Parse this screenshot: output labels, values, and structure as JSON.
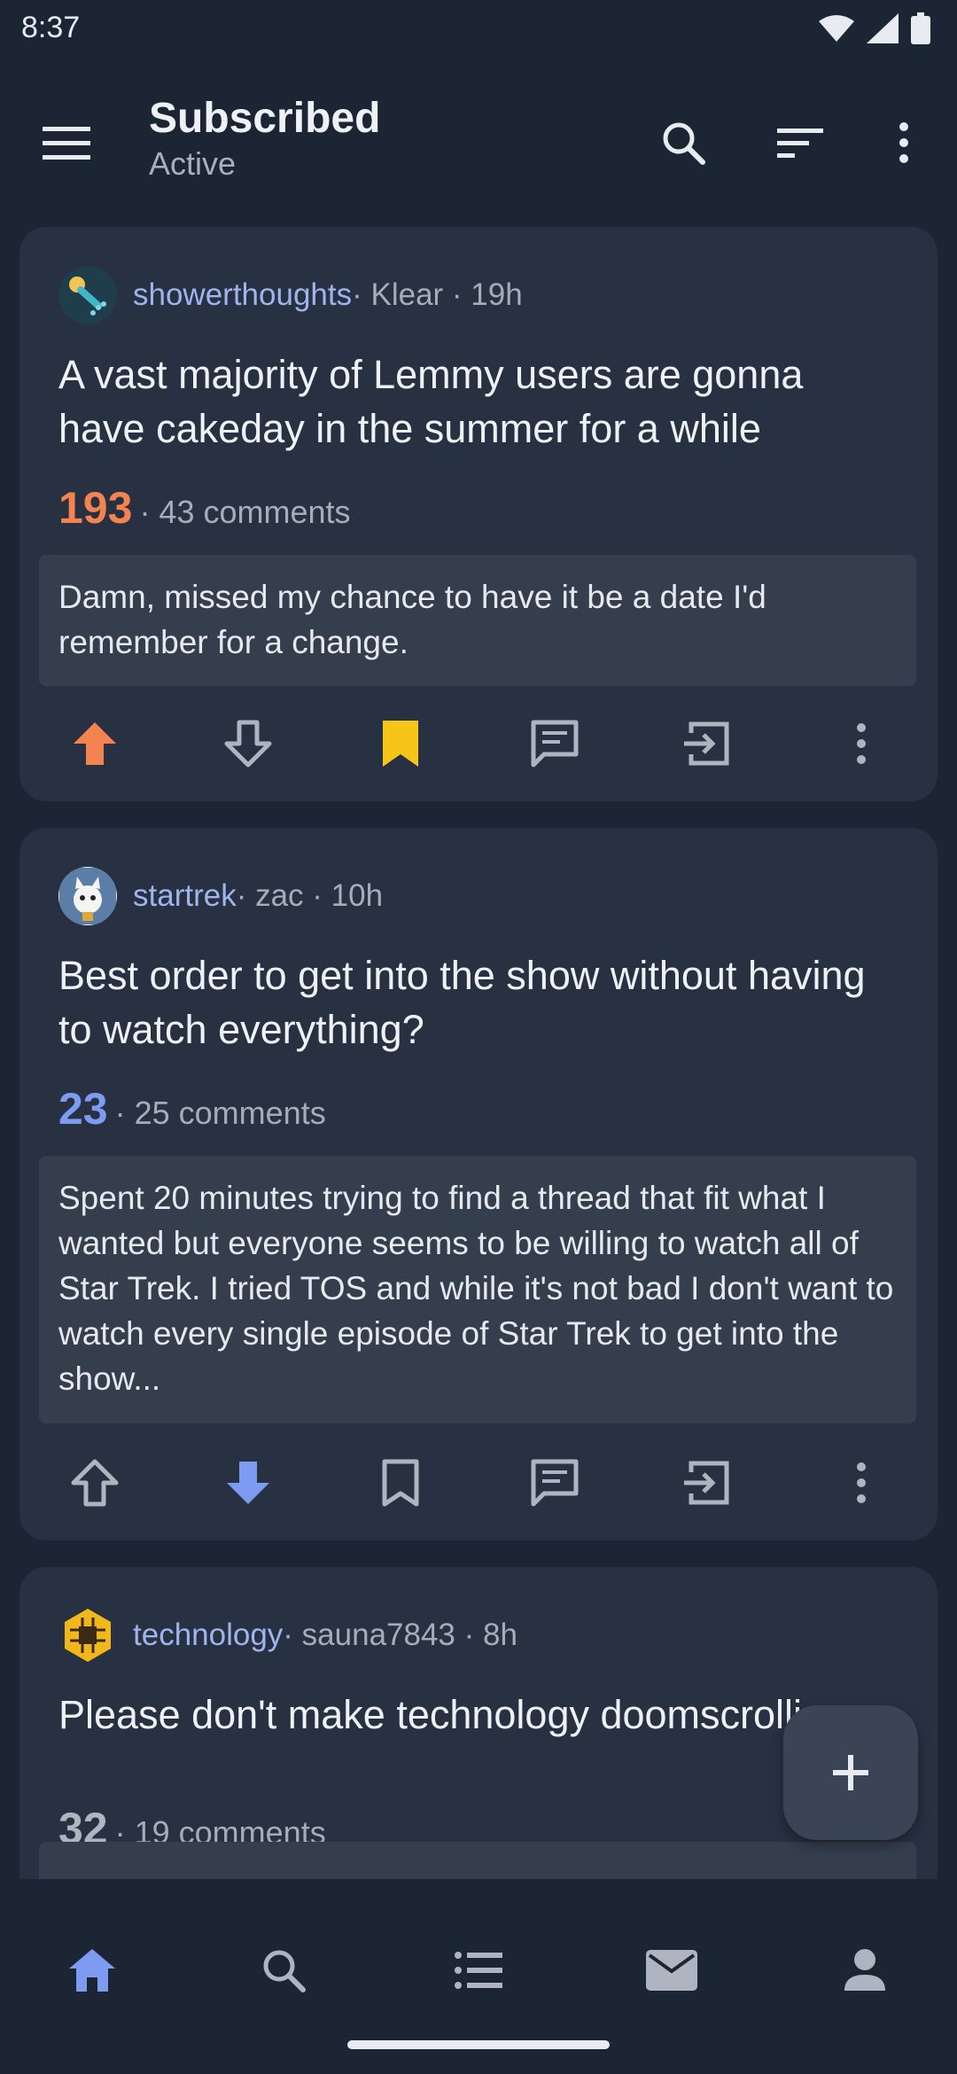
{
  "status_bar": {
    "time": "8:37"
  },
  "app_bar": {
    "title": "Subscribed",
    "subtitle": "Active",
    "icons": [
      "menu-icon",
      "search-icon",
      "sort-icon",
      "more-vert-icon"
    ]
  },
  "posts": [
    {
      "community": "showerthoughts",
      "meta": " · Klear · 19h",
      "title": "A vast majority of Lemmy users are gonna have cakeday in the summer for a while",
      "score": "193",
      "comments": " · 43 comments",
      "body": "Damn, missed my chance to have it be a date I'd remember for a change.",
      "vote_state": "upvoted",
      "saved": true
    },
    {
      "community": "startrek",
      "meta": " · zac · 10h",
      "title": "Best order to get into the show without having to watch everything?",
      "score": "23",
      "comments": " · 25 comments",
      "body": "Spent 20 minutes trying to find a thread that fit what I wanted but everyone seems to be willing to watch all of Star Trek. I tried TOS and while it's not bad I don't want to watch every single episode of Star Trek to get into the show...",
      "vote_state": "downvoted",
      "saved": false
    },
    {
      "community": "technology",
      "meta": " · sauna7843 · 8h",
      "title": "Please don't make technology doomscrolli",
      "score": "32",
      "comments": " · 19 comments",
      "vote_state": "none"
    }
  ],
  "colors": {
    "upvote": "#f58350",
    "downvote": "#7d9bf0",
    "saved": "#f5c518",
    "neutral_icon": "#aeb5c0",
    "community_link": "#9fb4ec"
  },
  "bottom_nav": {
    "items": [
      "home-icon",
      "search-icon",
      "list-icon",
      "mail-icon",
      "person-icon"
    ],
    "active": "home"
  }
}
